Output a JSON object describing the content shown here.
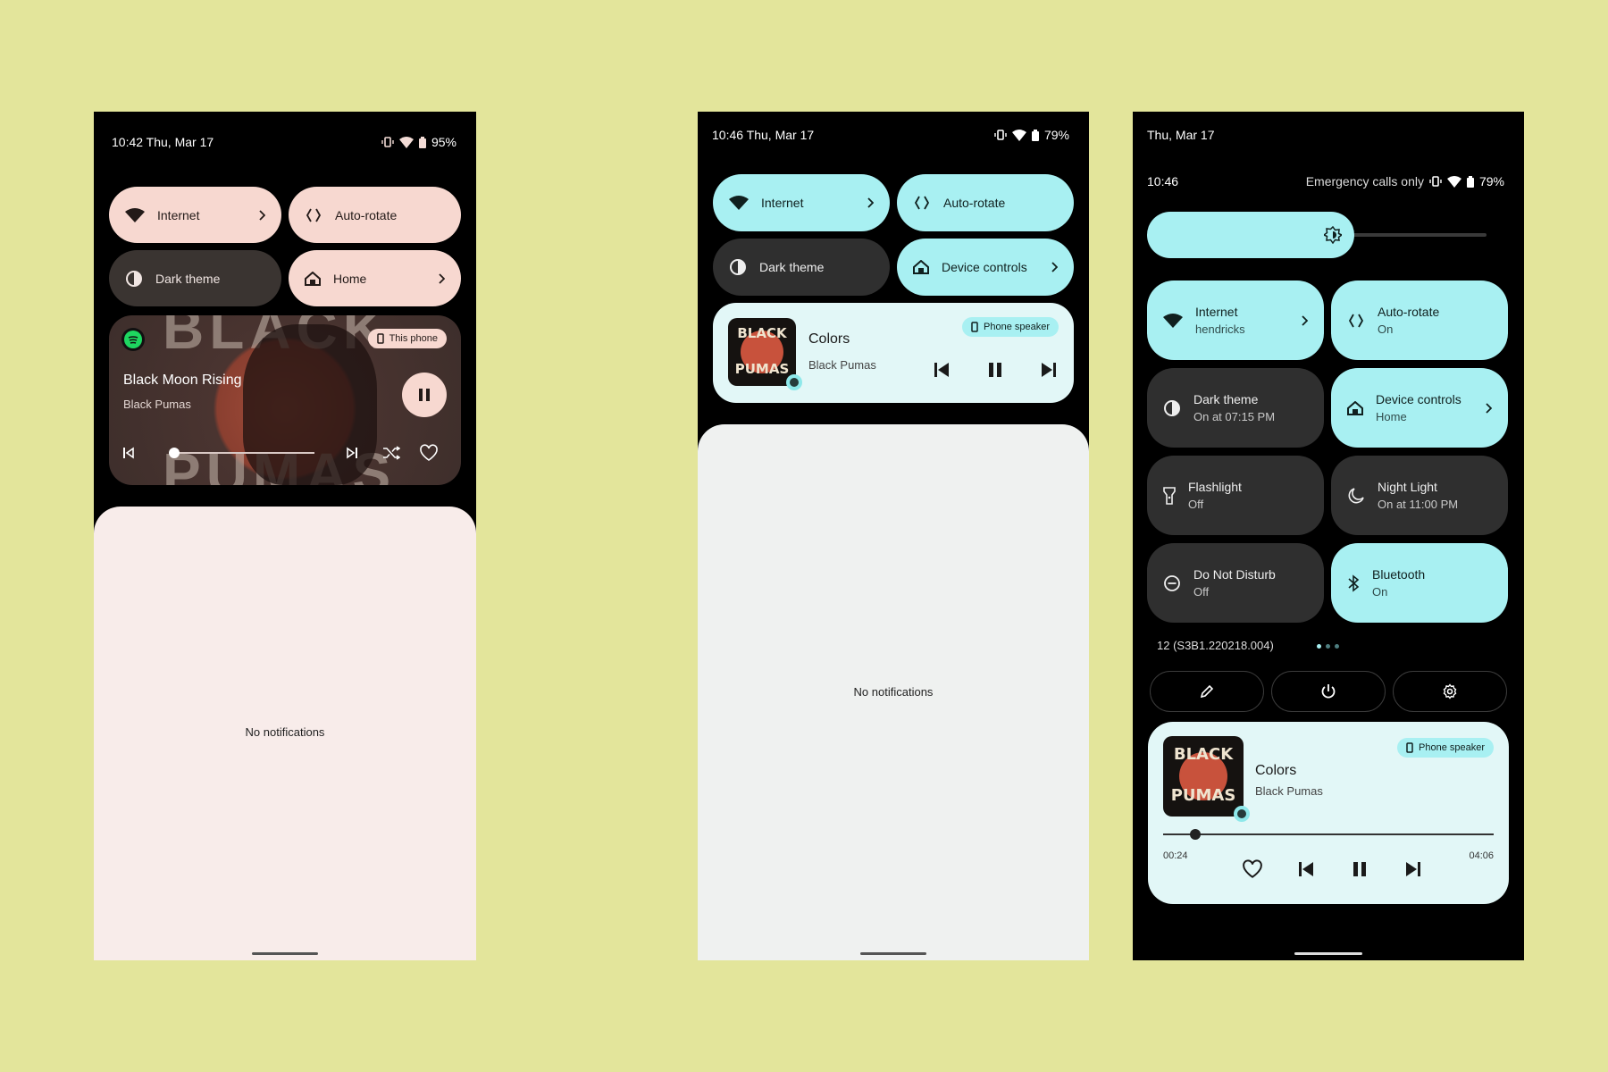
{
  "phone1": {
    "status": {
      "time_date": "10:42 Thu, Mar 17",
      "battery": "95%"
    },
    "tiles": [
      {
        "label": "Internet",
        "icon": "wifi-icon",
        "chevron": true,
        "state": "on"
      },
      {
        "label": "Auto-rotate",
        "icon": "rotate-icon",
        "chevron": false,
        "state": "on"
      },
      {
        "label": "Dark theme",
        "icon": "contrast-icon",
        "chevron": false,
        "state": "off"
      },
      {
        "label": "Home",
        "icon": "home-icon",
        "chevron": true,
        "state": "on"
      }
    ],
    "media": {
      "app": "Spotify",
      "output_chip": "This phone",
      "title": "Black Moon Rising",
      "artist": "Black Pumas",
      "art_text_top": "BLACK",
      "art_text_bottom": "PUMAS",
      "progress": 0.02
    },
    "notifications": {
      "empty_text": "No notifications"
    },
    "colors": {
      "accent": "#f7d8d0",
      "panel": "#f8ecea"
    }
  },
  "phone2": {
    "status": {
      "time_date": "10:46 Thu, Mar 17",
      "battery": "79%"
    },
    "tiles": [
      {
        "label": "Internet",
        "icon": "wifi-icon",
        "chevron": true,
        "state": "on"
      },
      {
        "label": "Auto-rotate",
        "icon": "rotate-icon",
        "chevron": false,
        "state": "on"
      },
      {
        "label": "Dark theme",
        "icon": "contrast-icon",
        "chevron": false,
        "state": "off"
      },
      {
        "label": "Device controls",
        "icon": "home-icon",
        "chevron": true,
        "state": "on"
      }
    ],
    "media": {
      "output_chip": "Phone speaker",
      "title": "Colors",
      "artist": "Black Pumas",
      "art_text_top": "BLACK",
      "art_text_bottom": "PUMAS"
    },
    "notifications": {
      "empty_text": "No notifications"
    },
    "colors": {
      "accent": "#a8f0f2",
      "panel": "#eff1f0"
    }
  },
  "phone3": {
    "status": {
      "date": "Thu, Mar 17",
      "time": "10:46",
      "carrier": "Emergency calls only",
      "battery": "79%"
    },
    "brightness": 0.55,
    "tiles": [
      {
        "label": "Internet",
        "sub": "hendricks",
        "icon": "wifi-icon",
        "chevron": true,
        "state": "on"
      },
      {
        "label": "Auto-rotate",
        "sub": "On",
        "icon": "rotate-icon",
        "chevron": false,
        "state": "on"
      },
      {
        "label": "Dark theme",
        "sub": "On at 07:15 PM",
        "icon": "contrast-icon",
        "chevron": false,
        "state": "off"
      },
      {
        "label": "Device controls",
        "sub": "Home",
        "icon": "home-icon",
        "chevron": true,
        "state": "on"
      },
      {
        "label": "Flashlight",
        "sub": "Off",
        "icon": "flashlight-icon",
        "chevron": false,
        "state": "off"
      },
      {
        "label": "Night Light",
        "sub": "On at 11:00 PM",
        "icon": "moon-icon",
        "chevron": false,
        "state": "off"
      },
      {
        "label": "Do Not Disturb",
        "sub": "Off",
        "icon": "dnd-icon",
        "chevron": false,
        "state": "off"
      },
      {
        "label": "Bluetooth",
        "sub": "On",
        "icon": "bluetooth-icon",
        "chevron": false,
        "state": "on"
      }
    ],
    "build": "12 (S3B1.220218.004)",
    "page_indicator": {
      "count": 3,
      "active": 0
    },
    "footer_buttons": [
      "edit-icon",
      "power-icon",
      "settings-icon"
    ],
    "media": {
      "output_chip": "Phone speaker",
      "title": "Colors",
      "artist": "Black Pumas",
      "art_text_top": "BLACK",
      "art_text_bottom": "PUMAS",
      "elapsed": "00:24",
      "duration": "04:06",
      "progress": 0.098
    }
  }
}
